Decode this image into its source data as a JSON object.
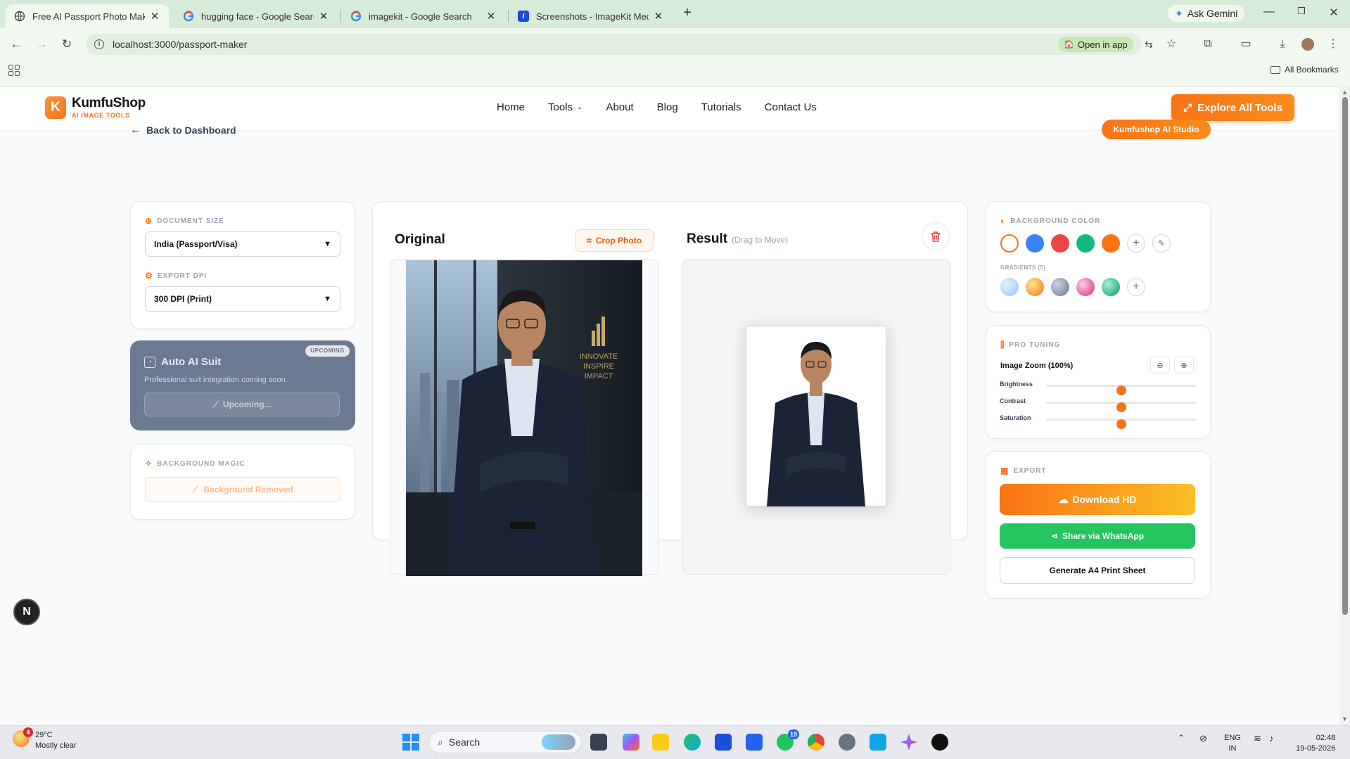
{
  "browser": {
    "tabs": [
      {
        "title": "Free AI Passport Photo Maker &",
        "active": true
      },
      {
        "title": "hugging face - Google Search",
        "active": false
      },
      {
        "title": "imagekit - Google Search",
        "active": false
      },
      {
        "title": "Screenshots - ImageKit Media L",
        "active": false
      }
    ],
    "ask_gemini": "Ask Gemini",
    "url": "localhost:3000/passport-maker",
    "open_in_app": "Open in app",
    "all_bookmarks": "All Bookmarks"
  },
  "site": {
    "logo_name": "KumfuShop",
    "logo_tag": "AI IMAGE TOOLS",
    "logo_letter": "K",
    "nav": [
      "Home",
      "Tools",
      "About",
      "Blog",
      "Tutorials",
      "Contact Us"
    ],
    "explore_label": "Explore All Tools",
    "brand_color": "#f97316"
  },
  "page": {
    "back_label": "Back to Dashboard",
    "studio_badge": "Kumfushop AI Studio"
  },
  "left": {
    "document_size_label": "DOCUMENT SIZE",
    "document_size_value": "India (Passport/Visa)",
    "export_dpi_label": "EXPORT DPI",
    "export_dpi_value": "300 DPI (Print)",
    "auto_suit": {
      "badge": "UPCOMING",
      "title": "Auto AI Suit",
      "desc": "Professional suit integration coming soon.",
      "button": "Upcoming..."
    },
    "bg_magic_label": "BACKGROUND MAGIC",
    "bg_removed_label": "Background Removed"
  },
  "center": {
    "original_title": "Original",
    "crop_label": "Crop Photo",
    "result_title": "Result",
    "drag_hint": "(Drag to Move)",
    "office_sign": [
      "INNOVATE",
      "INSPIRE",
      "IMPACT"
    ]
  },
  "right": {
    "bg_color_label": "BACKGROUND COLOR",
    "colors": [
      "#ffffff",
      "#3b82f6",
      "#ef4444",
      "#10b981",
      "#f97316"
    ],
    "gradients_label": "GRADIENTS (5)",
    "pro_tuning_label": "PRO TUNING",
    "image_zoom_label": "Image Zoom (100%)",
    "sliders": [
      {
        "label": "Brightness",
        "value": 0.5
      },
      {
        "label": "Contrast",
        "value": 0.5
      },
      {
        "label": "Saturation",
        "value": 0.5
      }
    ],
    "export_label": "EXPORT",
    "download_label": "Download HD",
    "whatsapp_label": "Share via WhatsApp",
    "a4_label": "Generate A4 Print Sheet"
  },
  "floating": {
    "letter": "N"
  },
  "taskbar": {
    "weather_temp": "29°C",
    "weather_desc": "Mostly clear",
    "weather_badge": "4",
    "search_placeholder": "Search",
    "whatsapp_badge": "19",
    "lang_1": "ENG",
    "lang_2": "IN",
    "time": "02:48",
    "date": "19-05-2026"
  }
}
